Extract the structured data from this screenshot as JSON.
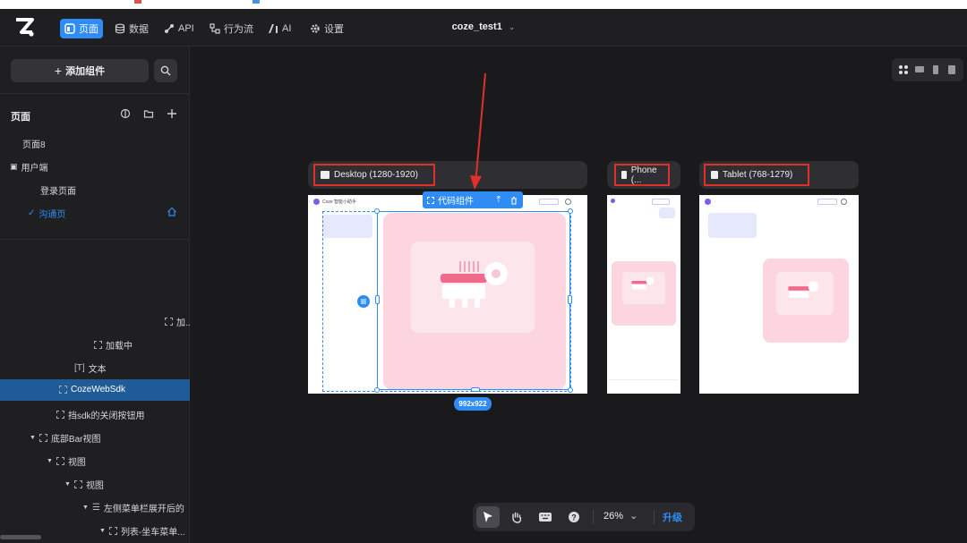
{
  "nav": {
    "items": [
      {
        "label": "页面",
        "icon": "page-icon",
        "active": true
      },
      {
        "label": "数据",
        "icon": "database-icon"
      },
      {
        "label": "API",
        "icon": "api-icon"
      },
      {
        "label": "行为流",
        "icon": "workflow-icon"
      },
      {
        "label": "AI",
        "icon": "ai-icon"
      },
      {
        "label": "设置",
        "icon": "settings-gear-icon"
      }
    ],
    "project_name": "coze_test1"
  },
  "sidebar": {
    "add_component": "添加组件",
    "section_title": "页面",
    "pages": [
      {
        "label": "页面8"
      },
      {
        "label": "用户端"
      },
      {
        "label": "登录页面"
      },
      {
        "label": "沟通页"
      }
    ],
    "layers": [
      {
        "label": "加..."
      },
      {
        "label": "加载中"
      },
      {
        "label": "文本"
      },
      {
        "label": "CozeWebSdk"
      },
      {
        "label": "挡sdk的关闭按钮用"
      },
      {
        "label": "底部Bar视图"
      },
      {
        "label": "视图"
      },
      {
        "label": "视图"
      },
      {
        "label": "左侧菜单栏展开后的"
      },
      {
        "label": "列表-坐车菜单..."
      }
    ]
  },
  "canvas": {
    "frames": [
      {
        "label": "Desktop (1280-1920)"
      },
      {
        "label": "Phone (..."
      },
      {
        "label": "Tablet (768-1279)"
      }
    ],
    "selection_label": "代码组件",
    "selection_size": "992x922",
    "mini_app_title": "Coze 智能小助手"
  },
  "toolbar": {
    "zoom": "26%",
    "upgrade": "升级"
  },
  "colors": {
    "accent": "#2f8cf5",
    "highlight_red": "#e0302c",
    "pink": "#fdd5de"
  }
}
